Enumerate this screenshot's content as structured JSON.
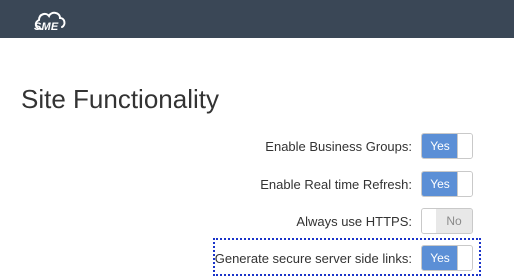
{
  "app": {
    "logo_text": "SME",
    "logo_icon": "cloud-icon"
  },
  "page": {
    "title": "Site Functionality"
  },
  "settings": [
    {
      "label": "Enable Business Groups:",
      "value": "Yes",
      "state": "on"
    },
    {
      "label": "Enable Real time Refresh:",
      "value": "Yes",
      "state": "on"
    },
    {
      "label": "Always use HTTPS:",
      "value": "No",
      "state": "off"
    },
    {
      "label": "Generate secure server side links:",
      "value": "Yes",
      "state": "on",
      "highlighted": true
    }
  ],
  "colors": {
    "topbar": "#3a4756",
    "toggle_on": "#5b8fd6",
    "highlight": "#1a33c9"
  }
}
